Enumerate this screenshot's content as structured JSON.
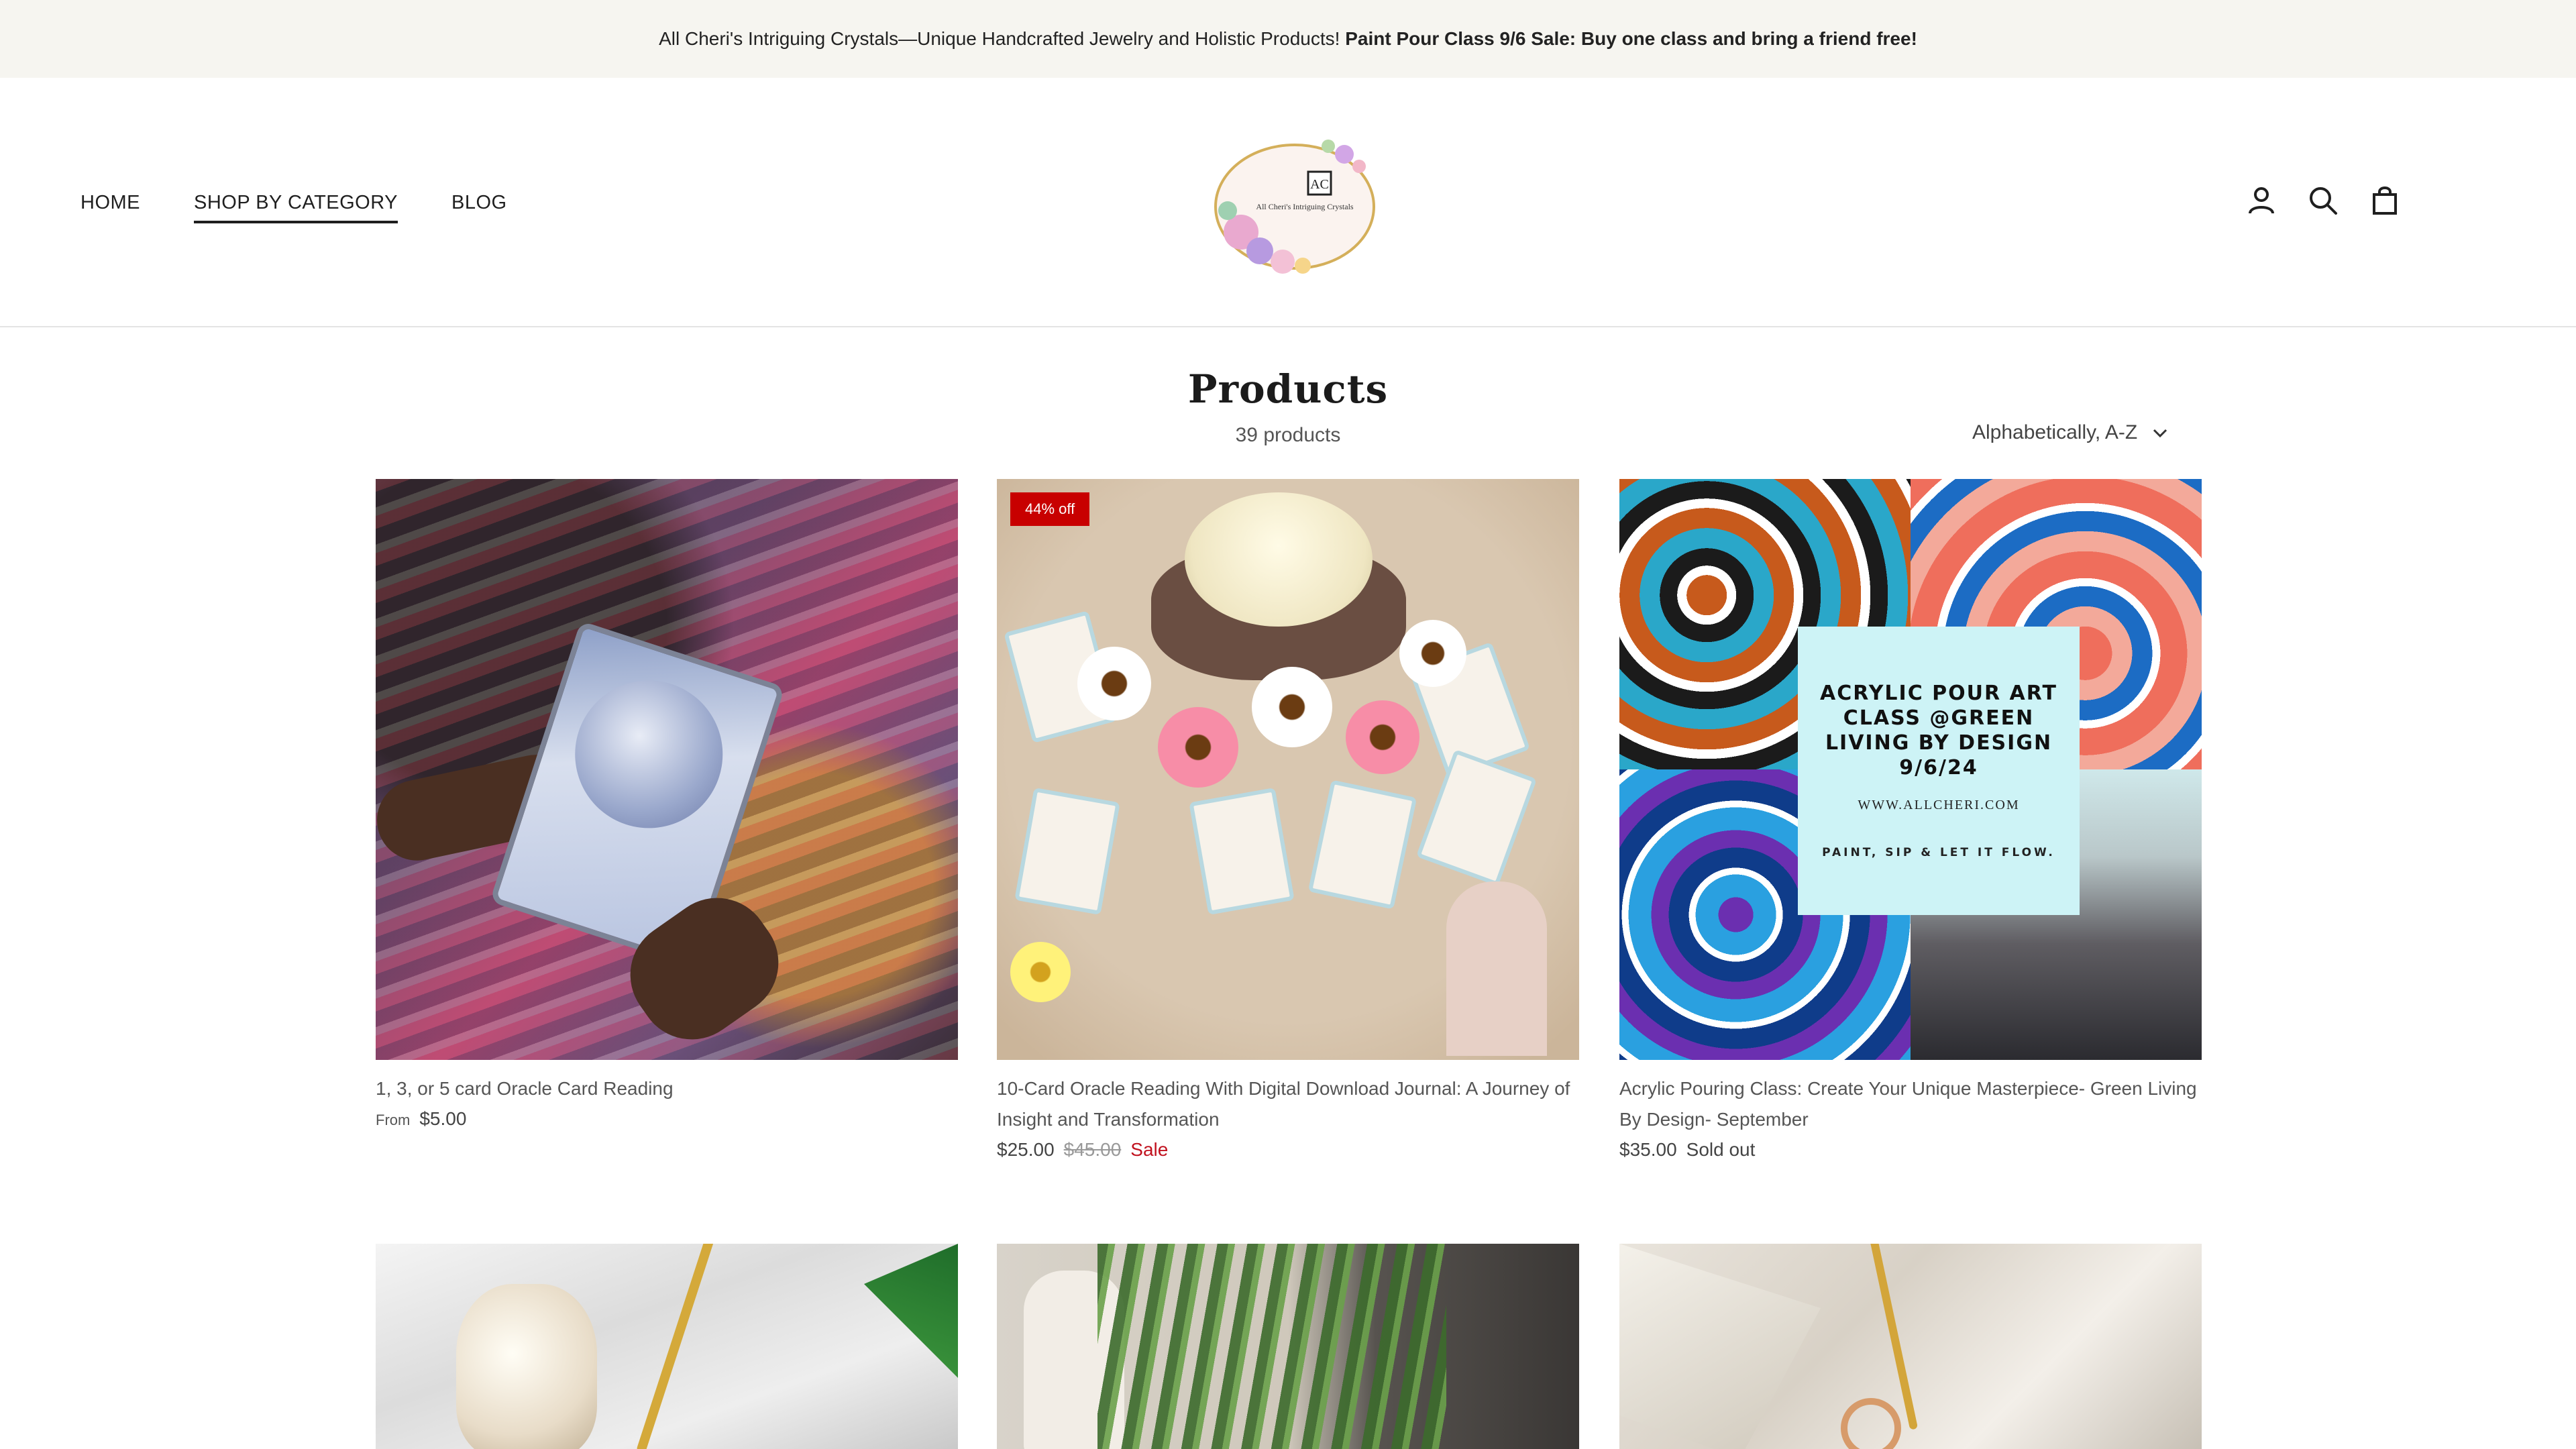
{
  "announcement": {
    "normal": "All Cheri's Intriguing Crystals—Unique Handcrafted Jewelry and Holistic Products!",
    "bold": "Paint Pour Class 9/6 Sale: Buy one class and bring a friend free!"
  },
  "nav": {
    "items": [
      {
        "label": "HOME",
        "active": false
      },
      {
        "label": "SHOP BY CATEGORY",
        "active": true
      },
      {
        "label": "BLOG",
        "active": false
      }
    ]
  },
  "logo": {
    "text": "All Cheri's Intriguing Crystals",
    "monogram": "AC"
  },
  "header_icons": [
    "account-icon",
    "search-icon",
    "cart-icon"
  ],
  "collection": {
    "title": "Products",
    "count": "39 products",
    "sort_label": "Alphabetically, A-Z"
  },
  "products": [
    {
      "title": "1, 3, or 5 card Oracle Card Reading",
      "price_prefix": "From",
      "price": "$5.00"
    },
    {
      "title": "10-Card Oracle Reading With Digital Download Journal: A Journey of Insight and Transformation",
      "badge": "44% off",
      "price": "$25.00",
      "compare_price": "$45.00",
      "status": "Sale"
    },
    {
      "title": "Acrylic Pouring Class: Create Your Unique Masterpiece- Green Living By Design- September",
      "price": "$35.00",
      "status": "Sold out",
      "image_text": {
        "heading": "ACRYLIC POUR ART CLASS @GREEN LIVING BY DESIGN 9/6/24",
        "url": "WWW.ALLCHERI.COM",
        "tagline": "PAINT, SIP & LET IT FLOW."
      }
    }
  ],
  "colors": {
    "announcement_bg": "#f6f5f0",
    "badge": "#c80000",
    "sale_text": "#c1121f",
    "text": "#2b2b2b"
  }
}
